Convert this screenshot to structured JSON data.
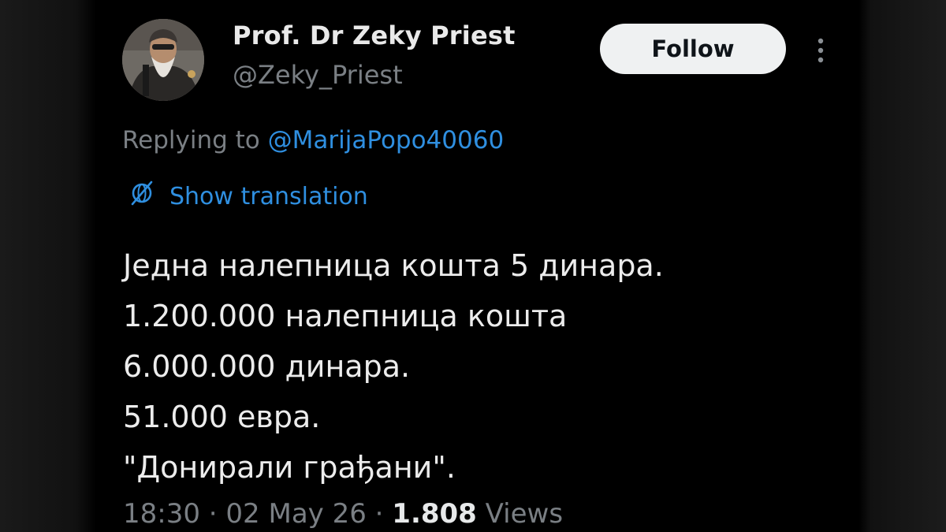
{
  "tweet": {
    "author_name": "Prof. Dr Zeky Priest",
    "author_handle": "@Zeky_Priest",
    "follow_label": "Follow",
    "reply_prefix": "Replying to",
    "reply_mention": "@MarijaPopo40060",
    "translation_label": "Show translation",
    "body_lines": [
      "Једна налепница кошта 5 динара.",
      "1.200.000 налепница кошта",
      "6.000.000 динара.",
      "51.000 евра.",
      "\"Донирали грађани\"."
    ],
    "time": "18:30",
    "date": "02 May 26",
    "views_count": "1.808",
    "views_label": "Views"
  },
  "colors": {
    "background": "#000000",
    "primary_text": "#ececec",
    "secondary_text": "#7a7f84",
    "link": "#2f8fe0",
    "follow_button_bg": "#eff1f2"
  },
  "icons": {
    "translate": "translate-globe-slash-icon",
    "more": "more-vertical-icon"
  }
}
